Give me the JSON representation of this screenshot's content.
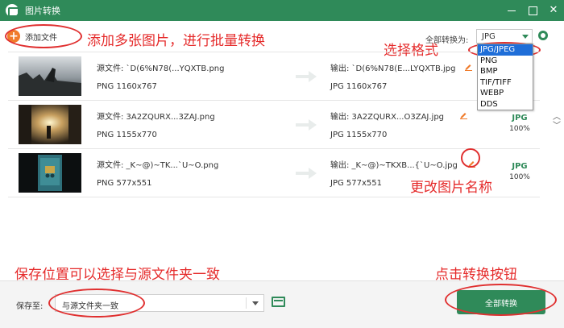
{
  "window": {
    "title": "图片转换"
  },
  "toolbar": {
    "add_files_label": "添加文件",
    "convert_to_label": "全部转换为:",
    "selected_format": "JPG"
  },
  "format_dropdown": {
    "options": [
      "JPG/JPEG",
      "PNG",
      "BMP",
      "TIF/TIFF",
      "WEBP",
      "DDS"
    ],
    "selected_index": 0
  },
  "files": [
    {
      "source_name": "源文件: `D(6%N78(...YQXTB.png",
      "source_info": "PNG   1160x767",
      "output_name": "输出: `D(6%N78(E...LYQXTB.jpg",
      "output_info": "JPG   1160x767"
    },
    {
      "source_name": "源文件: 3A2ZQURX...3ZAJ.png",
      "source_info": "PNG   1155x770",
      "output_name": "输出: 3A2ZQURX...O3ZAJ.jpg",
      "output_info": "JPG   1155x770",
      "badge_format": "JPG",
      "badge_percent": "100%"
    },
    {
      "source_name": "源文件: _K~@)~TK...`U~O.png",
      "source_info": "PNG   577x551",
      "output_name": "输出: _K~@)~TKXB...{`U~O.jpg",
      "output_info": "JPG   577x551",
      "badge_format": "JPG",
      "badge_percent": "100%"
    }
  ],
  "footer": {
    "save_to_label": "保存至:",
    "save_location": "与源文件夹一致",
    "convert_all_label": "全部转换"
  },
  "annotations": {
    "add_many": "添加多张图片，进行批量转换",
    "choose_format": "选择格式",
    "rename": "更改图片名称",
    "save_location_tip": "保存位置可以选择与源文件夹一致",
    "click_convert": "点击转换按钮"
  },
  "colors": {
    "brand_green": "#2f8a59",
    "annotation_red": "#e52b2b",
    "accent_orange": "#f07b2b",
    "selection_blue": "#1f6ed8"
  },
  "icons": [
    "app-logo-icon",
    "minimize-icon",
    "maximize-icon",
    "close-icon",
    "plus-circle-icon",
    "gear-icon",
    "arrow-right-icon",
    "pencil-edit-icon",
    "folder-icon",
    "chevron-up-icon",
    "chevron-down-icon"
  ]
}
